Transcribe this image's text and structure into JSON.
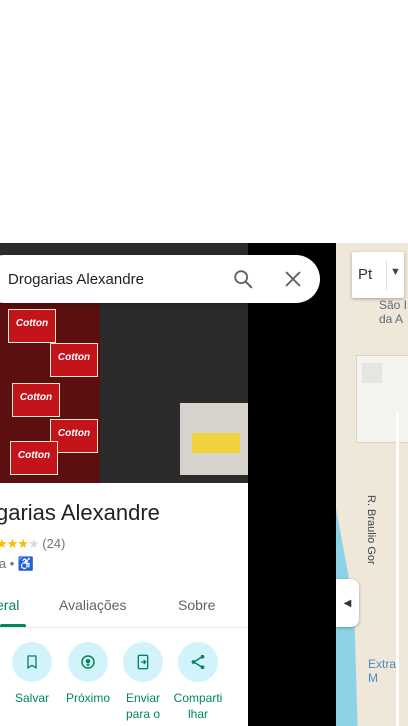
{
  "search": {
    "value": "Drogarias Alexandre"
  },
  "place": {
    "title": "garias Alexandre",
    "rating_count": "(24)",
    "rating_stars": 4,
    "category": "ia •"
  },
  "tabs": [
    {
      "label": "eral"
    },
    {
      "label": "Avaliações"
    },
    {
      "label": "Sobre"
    }
  ],
  "actions": [
    {
      "label": "Salvar",
      "icon": "bookmark-icon"
    },
    {
      "label": "Próximo",
      "icon": "nearby-icon"
    },
    {
      "label": "Enviar para o",
      "icon": "send-to-phone-icon"
    },
    {
      "label": "Comparti lhar",
      "icon": "share-icon"
    }
  ],
  "map": {
    "layer_label": "Pt",
    "label_sao": "São I da A",
    "label_road": "R. Braulio Gor",
    "label_extra": "Extra M"
  },
  "photo": {
    "product_text": "Cotton"
  },
  "colors": {
    "accent": "#01875f",
    "star": "#fbbc04",
    "action_bg": "#d2f3fa",
    "water": "#8dd3e7"
  }
}
